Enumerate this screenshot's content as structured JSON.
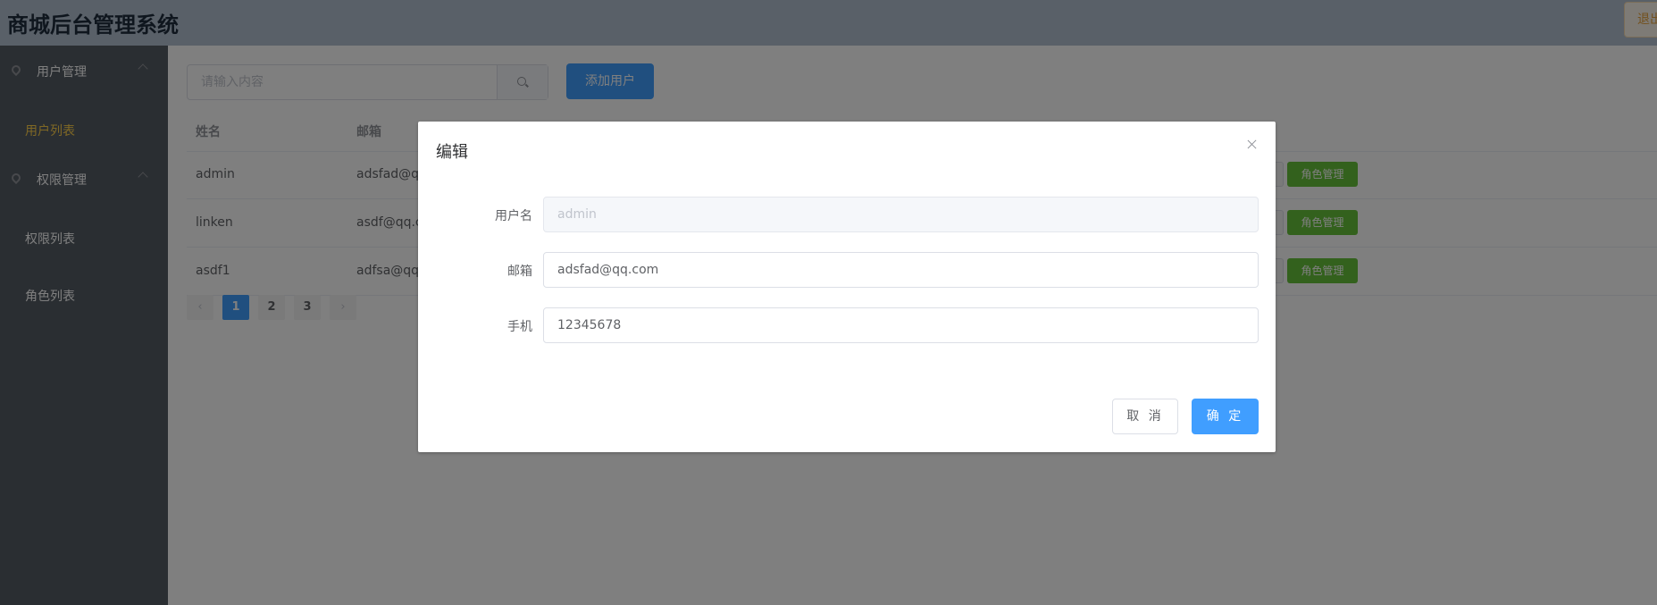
{
  "app": {
    "title": "商城后台管理系统",
    "logout_label": "退出"
  },
  "sidebar": {
    "groups": [
      {
        "label": "用户管理",
        "items": [
          {
            "label": "用户列表",
            "active": true
          }
        ]
      },
      {
        "label": "权限管理",
        "items": [
          {
            "label": "权限列表"
          },
          {
            "label": "角色列表"
          }
        ]
      }
    ]
  },
  "toolbar": {
    "search_placeholder": "请输入内容",
    "search_value": "",
    "add_label": "添加用户"
  },
  "table": {
    "columns": [
      "姓名",
      "邮箱"
    ],
    "rows": [
      {
        "name": "admin",
        "email": "adsfad@q",
        "action": "角色管理"
      },
      {
        "name": "linken",
        "email": "asdf@qq.c",
        "action": "角色管理"
      },
      {
        "name": "asdf1",
        "email": "adfsa@qq.",
        "action": "角色管理"
      }
    ]
  },
  "pagination": {
    "prev": "‹",
    "next": "›",
    "pages": [
      "1",
      "2",
      "3"
    ],
    "current": "1"
  },
  "dialog": {
    "title": "编辑",
    "fields": {
      "username": {
        "label": "用户名",
        "value": "admin",
        "disabled": true
      },
      "email": {
        "label": "邮箱",
        "value": "adsfad@qq.com"
      },
      "phone": {
        "label": "手机",
        "value": "12345678"
      }
    },
    "cancel_label": "取 消",
    "ok_label": "确 定"
  },
  "colors": {
    "primary": "#409eff",
    "success": "#67c23a",
    "sidebar_bg": "#545c64",
    "active_menu": "#ffd04b",
    "header_bg": "#b3c0d1"
  },
  "icons": {
    "menu": "location-pin-icon",
    "search": "search-icon",
    "close": "close-icon"
  }
}
